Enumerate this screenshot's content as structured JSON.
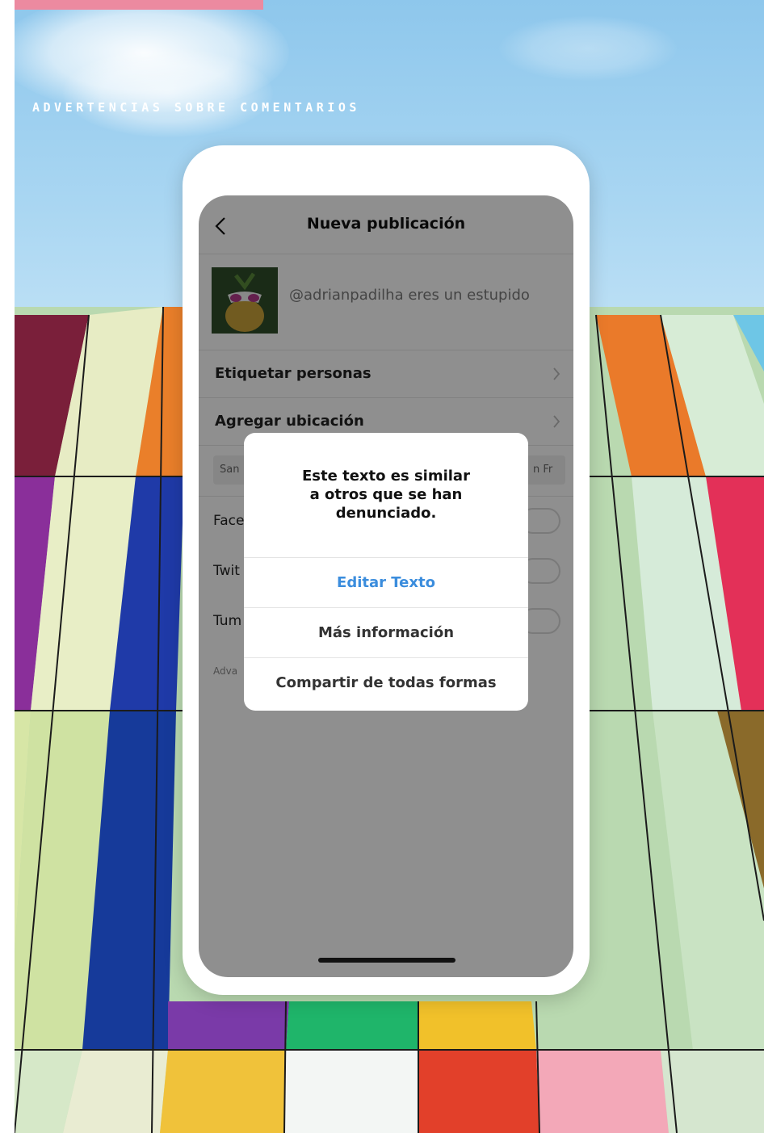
{
  "heading": "ADVERTENCIAS SOBRE COMENTARIOS",
  "colors": {
    "accent_pink": "#ec8aa0",
    "link_blue": "#3b8ddd"
  },
  "phone": {
    "nav": {
      "back_icon": "chevron-left-icon",
      "title": "Nueva publicación"
    },
    "post": {
      "caption": "@adrianpadilha eres un estupido"
    },
    "menu": [
      {
        "label": "Etiquetar personas",
        "icon": "chevron-right-icon"
      },
      {
        "label": "Agregar ubicación",
        "icon": "chevron-right-icon"
      }
    ],
    "location_chips": [
      "San",
      "n Fr"
    ],
    "share_targets": [
      {
        "label": "Face"
      },
      {
        "label": "Twit"
      },
      {
        "label": "Tum"
      }
    ],
    "advanced_label": "Adva",
    "alert": {
      "message": "Este texto es similar\na otros que se han\ndenunciado.",
      "buttons": [
        {
          "label": "Editar Texto",
          "primary": true
        },
        {
          "label": "Más información",
          "primary": false
        },
        {
          "label": "Compartir de todas formas",
          "primary": false
        }
      ]
    }
  }
}
